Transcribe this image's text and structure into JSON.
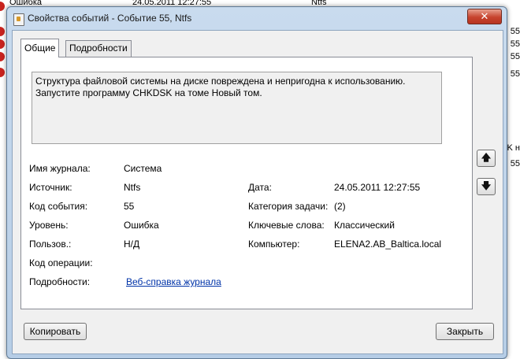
{
  "background": {
    "row": {
      "c1": "Ошибка",
      "c2": "24.05.2011 12:27:55",
      "c3": "Ntfs"
    },
    "right_texts": [
      "55",
      "55",
      "55",
      "55",
      "K н",
      "55"
    ]
  },
  "window": {
    "title": "Свойства событий - Событие 55, Ntfs",
    "close_glyph": "✕"
  },
  "tabs": [
    {
      "label": "Общие"
    },
    {
      "label": "Подробности"
    }
  ],
  "description": {
    "line1": "Структура файловой системы на диске повреждена и непригодна к использованию.",
    "line2": "Запустите программу CHKDSK на томе Новый том."
  },
  "fields": {
    "log_name": {
      "label": "Имя журнала:",
      "value": "Система"
    },
    "source": {
      "label": "Источник:",
      "value": "Ntfs"
    },
    "date": {
      "label": "Дата:",
      "value": "24.05.2011 12:27:55"
    },
    "event_code": {
      "label": "Код события:",
      "value": "55"
    },
    "task_category": {
      "label": "Категория задачи:",
      "value": "(2)"
    },
    "level": {
      "label": "Уровень:",
      "value": "Ошибка"
    },
    "keywords": {
      "label": "Ключевые слова:",
      "value": "Классический"
    },
    "user": {
      "label": "Пользов.:",
      "value": "Н/Д"
    },
    "computer": {
      "label": "Компьютер:",
      "value": "ELENA2.AB_Baltica.local"
    },
    "opcode": {
      "label": "Код операции:",
      "value": ""
    },
    "details": {
      "label": "Подробности:",
      "link": "Веб-справка журнала "
    }
  },
  "side_buttons": {
    "up_glyph": "🡅",
    "down_glyph": "🡇"
  },
  "buttons": {
    "copy": "Копировать",
    "close": "Закрыть"
  },
  "icons": {
    "app": "event-properties-icon",
    "error": "error-icon",
    "close": "close-icon",
    "up": "arrow-up-icon",
    "down": "arrow-down-icon"
  }
}
